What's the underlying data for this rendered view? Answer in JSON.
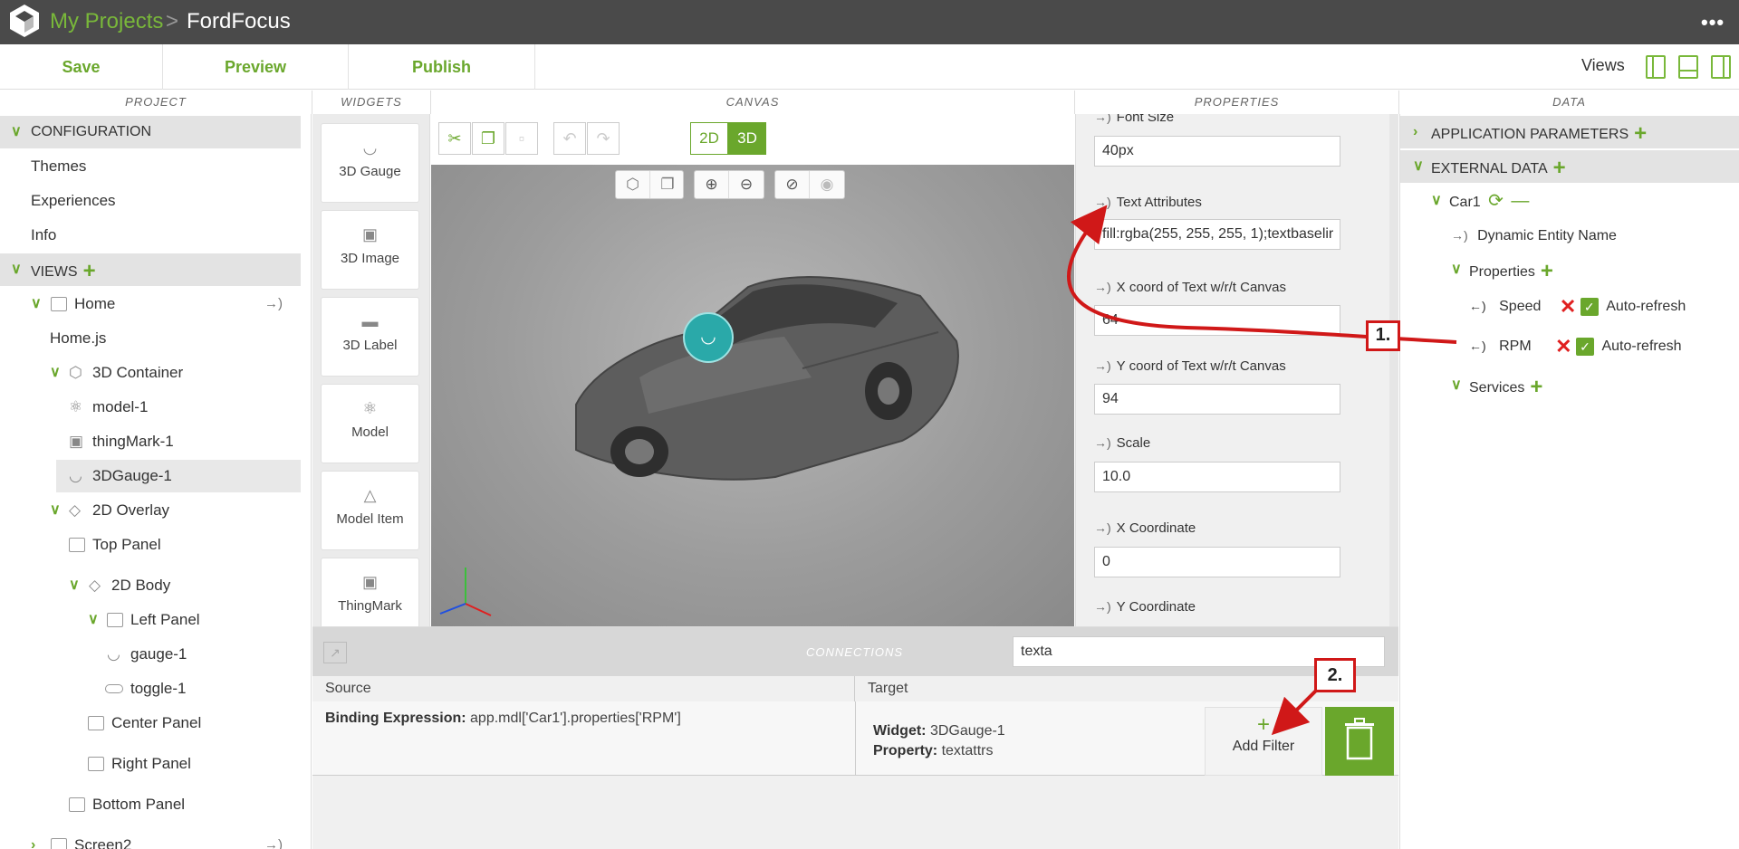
{
  "header": {
    "breadcrumb_root": "My Projects",
    "breadcrumb_sep": ">",
    "project_name": "FordFocus",
    "menu": "•••"
  },
  "toolbar": {
    "save": "Save",
    "preview": "Preview",
    "publish": "Publish",
    "views_label": "Views"
  },
  "sections": {
    "project": "PROJECT",
    "widgets": "WIDGETS",
    "canvas": "CANVAS",
    "properties": "PROPERTIES",
    "data": "DATA"
  },
  "project_tree": {
    "configuration": "CONFIGURATION",
    "themes": "Themes",
    "experiences": "Experiences",
    "info": "Info",
    "views": "VIEWS",
    "home": "Home",
    "home_js": "Home.js",
    "container_3d": "3D Container",
    "model_1": "model-1",
    "thingmark_1": "thingMark-1",
    "gauge_3d_1": "3DGauge-1",
    "overlay_2d": "2D Overlay",
    "top_panel": "Top Panel",
    "body_2d": "2D Body",
    "left_panel": "Left Panel",
    "gauge_1": "gauge-1",
    "toggle_1": "toggle-1",
    "center_panel": "Center Panel",
    "right_panel": "Right Panel",
    "bottom_panel": "Bottom Panel",
    "screen2": "Screen2"
  },
  "widgets": [
    "3D Gauge",
    "3D Image",
    "3D Label",
    "Model",
    "Model Item",
    "ThingMark"
  ],
  "canvas": {
    "mode_2d": "2D",
    "mode_3d": "3D",
    "active_mode": "3D"
  },
  "properties": {
    "font_size_label": "Font Size",
    "font_size_value": "40px",
    "text_attr_label": "Text Attributes",
    "text_attr_value": "fill:rgba(255, 255, 255, 1);textbaselir",
    "x_text_label": "X coord of Text w/r/t Canvas",
    "x_text_value": "64",
    "y_text_label": "Y coord of Text w/r/t Canvas",
    "y_text_value": "94",
    "scale_label": "Scale",
    "scale_value": "10.0",
    "x_coord_label": "X Coordinate",
    "x_coord_value": "0",
    "y_coord_label": "Y Coordinate"
  },
  "data_panel": {
    "app_params": "APPLICATION PARAMETERS",
    "external_data": "EXTERNAL DATA",
    "car1": "Car1",
    "dynamic_entity": "Dynamic Entity Name",
    "properties": "Properties",
    "speed": "Speed",
    "rpm": "RPM",
    "auto_refresh": "Auto-refresh",
    "services": "Services"
  },
  "connections": {
    "title": "CONNECTIONS",
    "search_value": "texta",
    "source_header": "Source",
    "target_header": "Target",
    "binding_label": "Binding Expression:",
    "binding_value": "app.mdl['Car1'].properties['RPM']",
    "widget_label": "Widget:",
    "widget_value": "3DGauge-1",
    "property_label": "Property:",
    "property_value": "textattrs",
    "add_filter": "Add Filter"
  },
  "annotations": {
    "step1": "1.",
    "step2": "2."
  },
  "colors": {
    "accent": "#6aa72c",
    "topbar": "#4a4a4a",
    "annotation": "#d01818"
  }
}
